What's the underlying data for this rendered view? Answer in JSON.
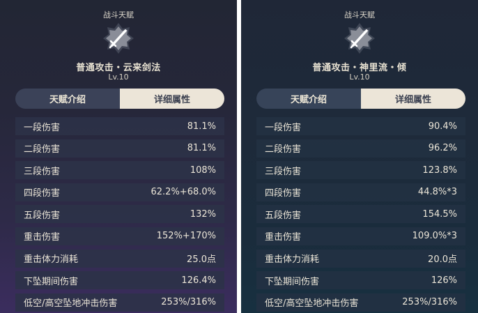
{
  "left": {
    "category": "战斗天赋",
    "talent_name": "普通攻击・云来剑法",
    "level": "Lv.10",
    "tabs": {
      "intro": "天赋介绍",
      "details": "详细属性"
    },
    "rows": [
      {
        "label": "一段伤害",
        "value": "81.1%"
      },
      {
        "label": "二段伤害",
        "value": "81.1%"
      },
      {
        "label": "三段伤害",
        "value": "108%"
      },
      {
        "label": "四段伤害",
        "value": "62.2%+68.0%"
      },
      {
        "label": "五段伤害",
        "value": "132%"
      },
      {
        "label": "重击伤害",
        "value": "152%+170%"
      },
      {
        "label": "重击体力消耗",
        "value": "25.0点"
      },
      {
        "label": "下坠期间伤害",
        "value": "126.4%"
      },
      {
        "label": "低空/高空坠地冲击伤害",
        "value": "253%/316%"
      }
    ]
  },
  "right": {
    "category": "战斗天赋",
    "talent_name": "普通攻击・神里流・倾",
    "level": "Lv.10",
    "tabs": {
      "intro": "天赋介绍",
      "details": "详细属性"
    },
    "rows": [
      {
        "label": "一段伤害",
        "value": "90.4%"
      },
      {
        "label": "二段伤害",
        "value": "96.2%"
      },
      {
        "label": "三段伤害",
        "value": "123.8%"
      },
      {
        "label": "四段伤害",
        "value": "44.8%*3"
      },
      {
        "label": "五段伤害",
        "value": "154.5%"
      },
      {
        "label": "重击伤害",
        "value": "109.0%*3"
      },
      {
        "label": "重击体力消耗",
        "value": "20.0点"
      },
      {
        "label": "下坠期间伤害",
        "value": "126%"
      },
      {
        "label": "低空/高空坠地冲击伤害",
        "value": "253%/316%"
      }
    ]
  },
  "icons": {
    "emblem": "sword-talent-icon"
  },
  "colors": {
    "active_tab": "#ece5d8",
    "inactive_tab": "#3b4258",
    "text": "#ece6d8"
  }
}
